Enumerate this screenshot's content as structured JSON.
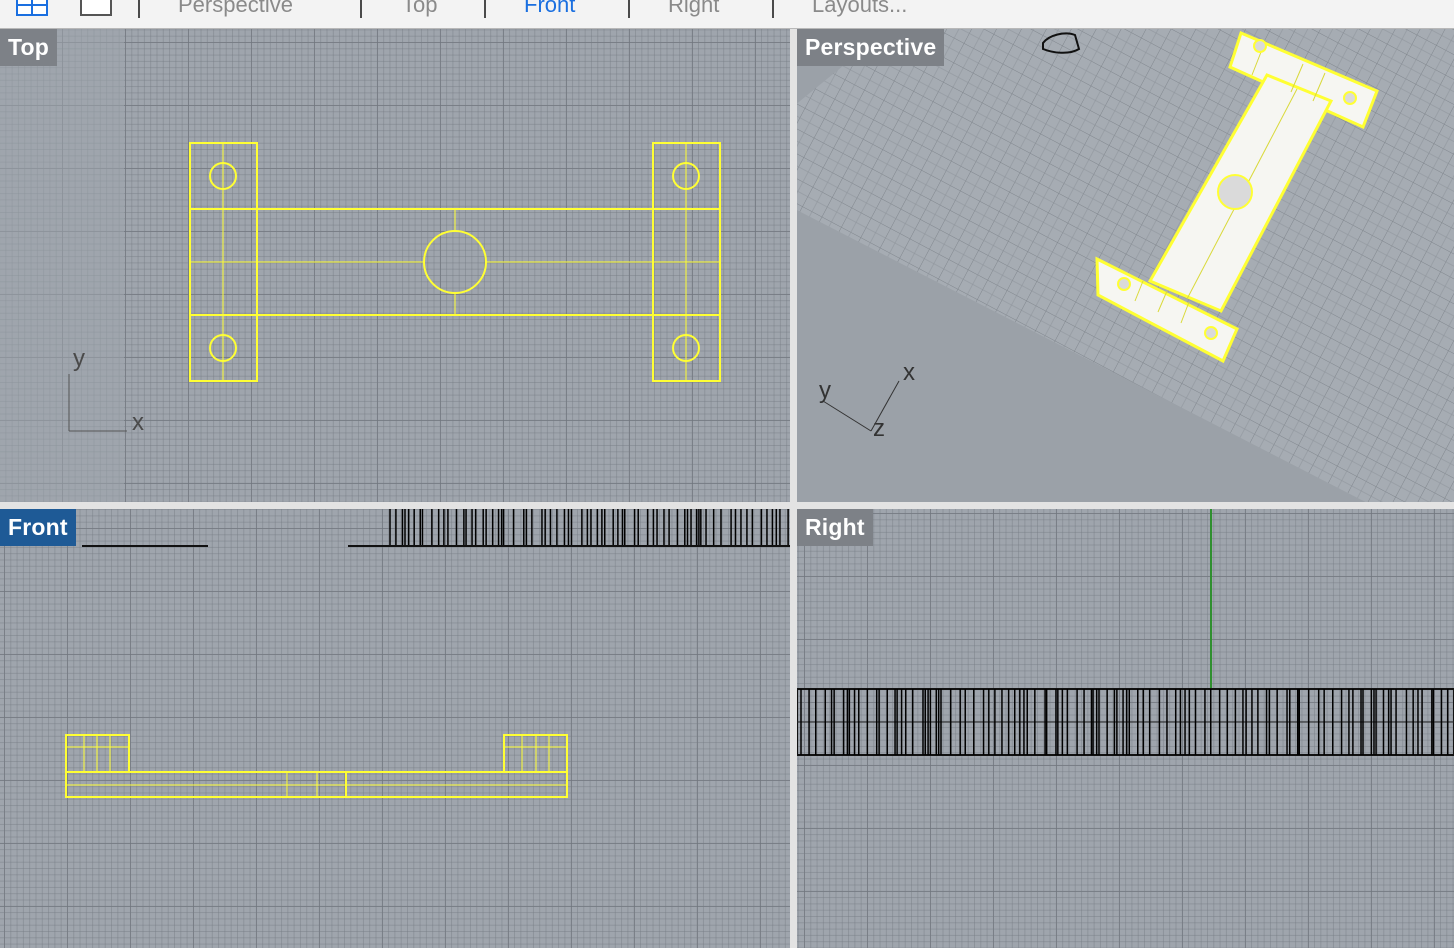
{
  "toolbar": {
    "tabs": [
      {
        "label": "Perspective"
      },
      {
        "label": "Top"
      },
      {
        "label": "Front"
      },
      {
        "label": "Right"
      },
      {
        "label": "Layouts..."
      }
    ],
    "active_tab": "Front"
  },
  "viewports": {
    "top": {
      "label": "Top",
      "axis_x": "x",
      "axis_y": "y"
    },
    "perspective": {
      "label": "Perspective",
      "axis_x": "x",
      "axis_y": "y",
      "axis_z": "z"
    },
    "front": {
      "label": "Front"
    },
    "right": {
      "label": "Right"
    }
  },
  "colors": {
    "selection": "#ffff33",
    "viewport_bg": "#9fa5ad",
    "active_label_bg": "#1e5a96",
    "inactive_label_bg": "#7d8187",
    "active_tab_text": "#1a6fe0",
    "z_axis_line": "#2f8f2f"
  }
}
